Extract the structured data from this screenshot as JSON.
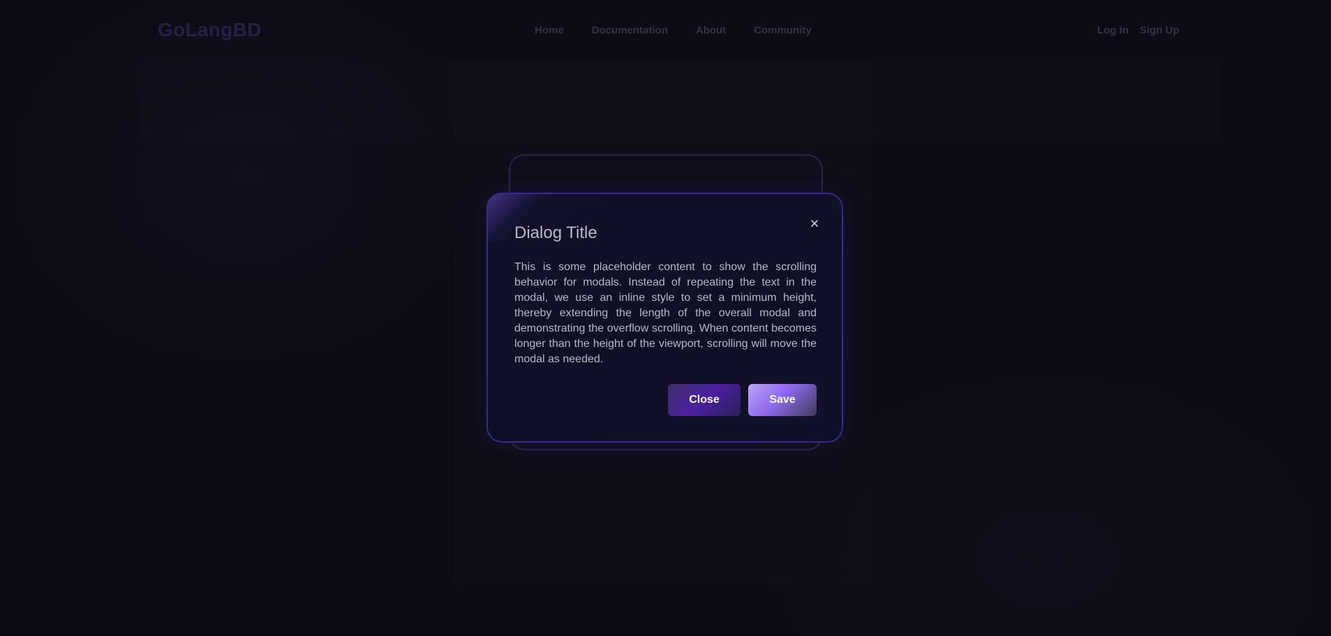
{
  "header": {
    "logo": "GoLangBD",
    "nav": [
      {
        "label": "Home"
      },
      {
        "label": "Documentation"
      },
      {
        "label": "About"
      },
      {
        "label": "Community"
      }
    ],
    "auth": {
      "login": "Log In",
      "signup": "Sign Up"
    }
  },
  "modal": {
    "title": "Dialog Title",
    "close_icon": "close-icon",
    "body": "This is some placeholder content to show the scrolling behavior for modals. Instead of repeating the text in the modal, we use an inline style to set a minimum height, thereby extending the length of the overall modal and demonstrating the overflow scrolling. When content becomes longer than the height of the viewport, scrolling will move the modal as needed.",
    "buttons": {
      "close": "Close",
      "save": "Save"
    }
  },
  "colors": {
    "background": "#110f1b",
    "logo": "#3a2d66",
    "modal_border": "#3a2a8a",
    "text": "#b8b7c6"
  }
}
